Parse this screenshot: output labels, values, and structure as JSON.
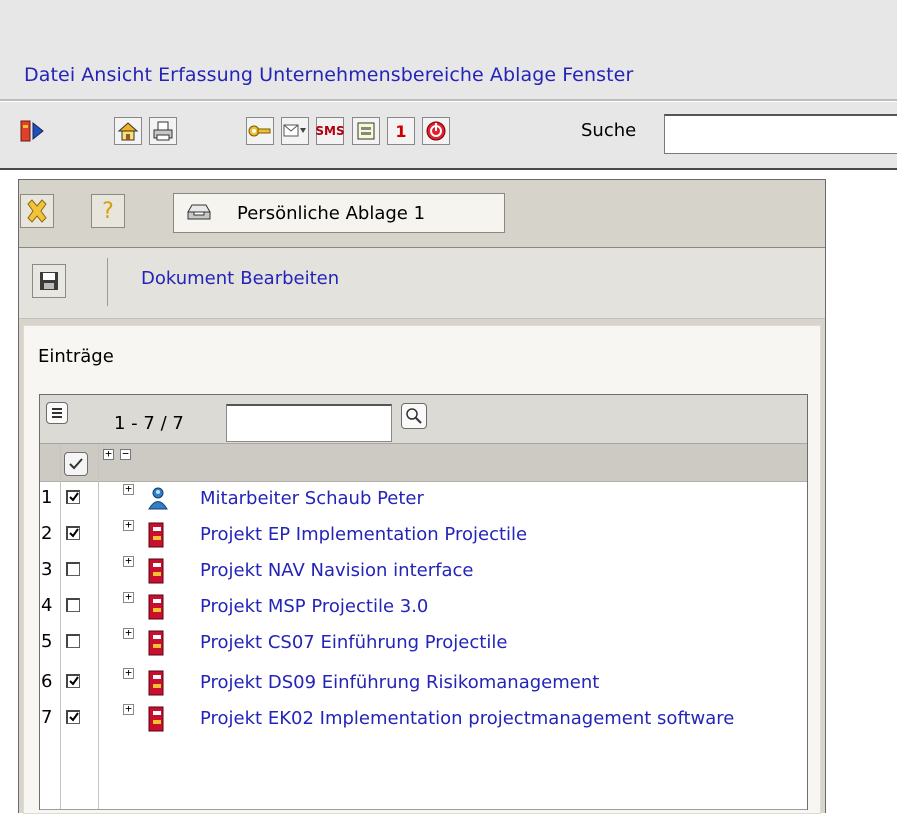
{
  "menu": {
    "items": [
      "Datei",
      "Ansicht",
      "Erfassung",
      "Unternehmensbereiche",
      "Ablage",
      "Fenster"
    ]
  },
  "toolbar": {
    "icons": [
      "exit-icon",
      "home-icon",
      "print-icon",
      "key-icon",
      "mail-icon",
      "sms-icon",
      "window-icon",
      "calendar-icon",
      "stop-icon"
    ],
    "sms_label": "SMS",
    "calendar_label": "1",
    "search_label": "Suche",
    "search_value": ""
  },
  "window": {
    "tab_title": "Persönliche Ablage 1",
    "doc_menu": [
      "Dokument",
      "Bearbeiten"
    ]
  },
  "list": {
    "heading": "Einträge",
    "range": "1 - 7 / 7",
    "filter_value": "",
    "expand_label": "+",
    "collapse_label": "−",
    "rows": [
      {
        "num": "1",
        "checked": true,
        "icon": "person-icon",
        "label": "Mitarbeiter Schaub Peter"
      },
      {
        "num": "2",
        "checked": true,
        "icon": "project-icon",
        "label": "Projekt EP Implementation Projectile"
      },
      {
        "num": "3",
        "checked": false,
        "icon": "project-icon",
        "label": "Projekt NAV Navision interface"
      },
      {
        "num": "4",
        "checked": false,
        "icon": "project-icon",
        "label": "Projekt MSP Projectile 3.0"
      },
      {
        "num": "5",
        "checked": false,
        "icon": "project-icon",
        "label": "Projekt CS07 Einführung Projectile"
      },
      {
        "num": "6",
        "checked": true,
        "icon": "project-icon",
        "label": "Projekt DS09 Einführung Risikomanagement"
      },
      {
        "num": "7",
        "checked": true,
        "icon": "project-icon",
        "label": "Projekt EK02 Implementation projectmanagement software"
      }
    ]
  },
  "colors": {
    "link": "#2424b8",
    "header_bg": "#e7e7e7",
    "panel_bg": "#d8d4cc",
    "project_red": "#c8102e",
    "person_blue": "#2f7fc9"
  }
}
